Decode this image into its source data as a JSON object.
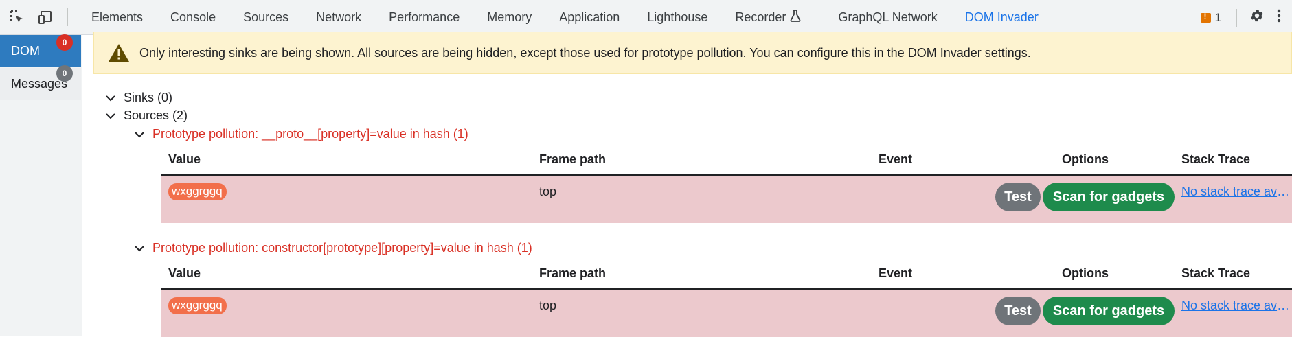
{
  "toolbar": {
    "tabs": [
      {
        "label": "Elements"
      },
      {
        "label": "Console"
      },
      {
        "label": "Sources"
      },
      {
        "label": "Network"
      },
      {
        "label": "Performance"
      },
      {
        "label": "Memory"
      },
      {
        "label": "Application"
      },
      {
        "label": "Lighthouse"
      },
      {
        "label": "Recorder"
      },
      {
        "label": "GraphQL Network"
      },
      {
        "label": "DOM Invader"
      }
    ],
    "active_tab": "DOM Invader",
    "issues_count": "1"
  },
  "sidebar": {
    "items": [
      {
        "label": "DOM",
        "badge": "0"
      },
      {
        "label": "Messages",
        "badge": "0"
      }
    ]
  },
  "warning": {
    "text": "Only interesting sinks are being shown. All sources are being hidden, except those used for prototype pollution. You can configure this in the DOM Invader settings."
  },
  "tree": {
    "sinks": "Sinks (0)",
    "sources": "Sources (2)",
    "groups": [
      {
        "title": "Prototype pollution: __proto__[property]=value in hash (1)",
        "value": "wxggrggq",
        "frame_path": "top",
        "stack_trace": "No stack trace available"
      },
      {
        "title": "Prototype pollution: constructor[prototype][property]=value in hash (1)",
        "value": "wxggrggq",
        "frame_path": "top",
        "stack_trace": "No stack trace available"
      }
    ]
  },
  "table_headers": {
    "value": "Value",
    "frame_path": "Frame path",
    "event": "Event",
    "options": "Options",
    "stack_trace": "Stack Trace"
  },
  "buttons": {
    "test": "Test",
    "scan": "Scan for gadgets"
  },
  "colors": {
    "accent": "#1a73e8",
    "sidebar_active": "#2e7bbf",
    "row_bg": "#ecc9cd",
    "value_pill": "#f26f4b",
    "scan_button": "#1e8b4c",
    "test_button": "#6f7479",
    "group_title": "#d93025",
    "warning_bg": "#fdf3d0"
  }
}
